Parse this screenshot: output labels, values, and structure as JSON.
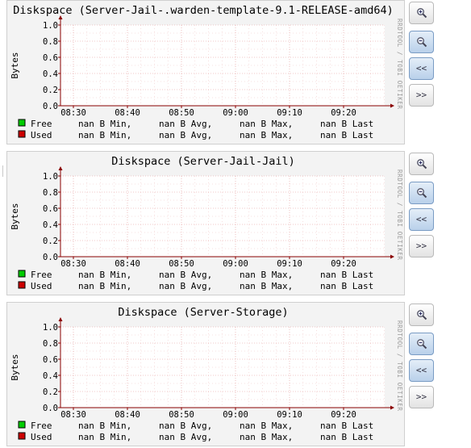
{
  "graphs": [
    {
      "title": "Diskspace (Server-Jail-.warden-template-9.1-RELEASE-amd64)",
      "ylabel": "Bytes",
      "side_label": "RRDTOOL / TOBI OETIKER",
      "chart_data": {
        "type": "line",
        "title": "Diskspace (Server-Jail-.warden-template-9.1-RELEASE-amd64)",
        "ylabel": "Bytes",
        "ylim": [
          0,
          1.0
        ],
        "y_ticks": [
          "0.0",
          "0.2",
          "0.4",
          "0.6",
          "0.8",
          "1.0"
        ],
        "x_ticks": [
          "08:30",
          "08:40",
          "08:50",
          "09:00",
          "09:10",
          "09:20"
        ],
        "grid": true,
        "series": [
          {
            "name": "Free",
            "values": []
          },
          {
            "name": "Used",
            "values": []
          }
        ]
      },
      "legend": [
        {
          "name": "Free",
          "color": "#00cc00",
          "min": "nan B Min,",
          "avg": "nan B Avg,",
          "max": "nan B Max,",
          "last": "nan B Last"
        },
        {
          "name": "Used",
          "color": "#cc0000",
          "min": "nan B Min,",
          "avg": "nan B Avg,",
          "max": "nan B Max,",
          "last": "nan B Last"
        }
      ]
    },
    {
      "title": "Diskspace (Server-Jail-Jail)",
      "ylabel": "Bytes",
      "side_label": "RRDTOOL / TOBI OETIKER",
      "chart_data": {
        "type": "line",
        "title": "Diskspace (Server-Jail-Jail)",
        "ylabel": "Bytes",
        "ylim": [
          0,
          1.0
        ],
        "y_ticks": [
          "0.0",
          "0.2",
          "0.4",
          "0.6",
          "0.8",
          "1.0"
        ],
        "x_ticks": [
          "08:30",
          "08:40",
          "08:50",
          "09:00",
          "09:10",
          "09:20"
        ],
        "grid": true,
        "series": [
          {
            "name": "Free",
            "values": []
          },
          {
            "name": "Used",
            "values": []
          }
        ]
      },
      "legend": [
        {
          "name": "Free",
          "color": "#00cc00",
          "min": "nan B Min,",
          "avg": "nan B Avg,",
          "max": "nan B Max,",
          "last": "nan B Last"
        },
        {
          "name": "Used",
          "color": "#cc0000",
          "min": "nan B Min,",
          "avg": "nan B Avg,",
          "max": "nan B Max,",
          "last": "nan B Last"
        }
      ]
    },
    {
      "title": "Diskspace (Server-Storage)",
      "ylabel": "Bytes",
      "side_label": "RRDTOOL / TOBI OETIKER",
      "chart_data": {
        "type": "line",
        "title": "Diskspace (Server-Storage)",
        "ylabel": "Bytes",
        "ylim": [
          0,
          1.0
        ],
        "y_ticks": [
          "0.0",
          "0.2",
          "0.4",
          "0.6",
          "0.8",
          "1.0"
        ],
        "x_ticks": [
          "08:30",
          "08:40",
          "08:50",
          "09:00",
          "09:10",
          "09:20"
        ],
        "grid": true,
        "series": [
          {
            "name": "Free",
            "values": []
          },
          {
            "name": "Used",
            "values": []
          }
        ]
      },
      "legend": [
        {
          "name": "Free",
          "color": "#00cc00",
          "min": "nan B Min,",
          "avg": "nan B Avg,",
          "max": "nan B Max,",
          "last": "nan B Last"
        },
        {
          "name": "Used",
          "color": "#cc0000",
          "min": "nan B Min,",
          "avg": "nan B Avg,",
          "max": "nan B Max,",
          "last": "nan B Last"
        }
      ]
    }
  ],
  "controls": [
    {
      "name": "zoom-in",
      "icon": "zoom-in-icon",
      "label": ""
    },
    {
      "name": "zoom-out",
      "icon": "zoom-out-icon",
      "label": ""
    },
    {
      "name": "back",
      "icon": "",
      "label": "<<"
    },
    {
      "name": "forward",
      "icon": "",
      "label": ">>"
    }
  ],
  "colors": {
    "grid": "#e08a8a",
    "axis": "#8a0000",
    "panel_bg": "#f3f3f3",
    "plot_bg": "#ffffff"
  }
}
